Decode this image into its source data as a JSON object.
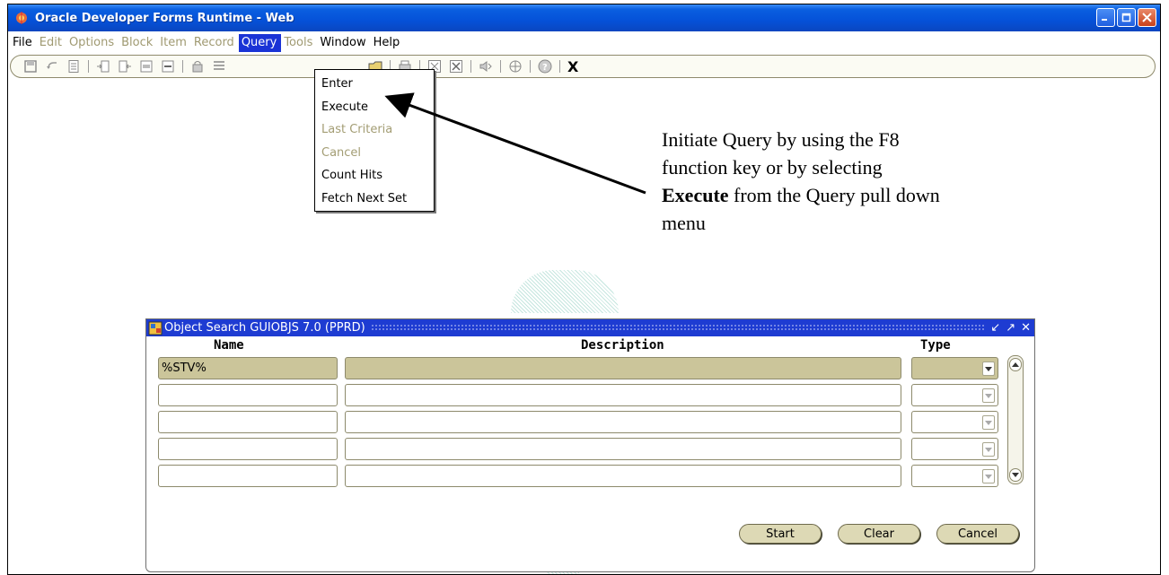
{
  "window": {
    "title": "Oracle Developer Forms Runtime - Web"
  },
  "menubar": {
    "items": [
      {
        "label": "File",
        "state": "enabled"
      },
      {
        "label": "Edit",
        "state": "disabled"
      },
      {
        "label": "Options",
        "state": "disabled"
      },
      {
        "label": "Block",
        "state": "disabled"
      },
      {
        "label": "Item",
        "state": "disabled"
      },
      {
        "label": "Record",
        "state": "disabled"
      },
      {
        "label": "Query",
        "state": "active"
      },
      {
        "label": "Tools",
        "state": "disabled"
      },
      {
        "label": "Window",
        "state": "enabled"
      },
      {
        "label": "Help",
        "state": "enabled"
      }
    ]
  },
  "toolbar": {
    "exit_label": "X"
  },
  "query_menu": {
    "items": [
      {
        "label": "Enter",
        "state": "enabled"
      },
      {
        "label": "Execute",
        "state": "enabled"
      },
      {
        "label": "Last Criteria",
        "state": "disabled"
      },
      {
        "label": "Cancel",
        "state": "disabled"
      },
      {
        "label": "Count Hits",
        "state": "enabled"
      },
      {
        "label": "Fetch Next Set",
        "state": "enabled"
      }
    ]
  },
  "annotation": {
    "line1": "Initiate Query by using the F8",
    "line2": "function key or by selecting",
    "bold": "Execute",
    "line3": " from the Query pull down",
    "line4": "menu"
  },
  "object_search": {
    "title": "Object Search  GUIOBJS  7.0  (PPRD)",
    "columns": {
      "name": "Name",
      "description": "Description",
      "type": "Type"
    },
    "rows": [
      {
        "name": "%STV%",
        "description": "",
        "type": ""
      },
      {
        "name": "",
        "description": "",
        "type": ""
      },
      {
        "name": "",
        "description": "",
        "type": ""
      },
      {
        "name": "",
        "description": "",
        "type": ""
      },
      {
        "name": "",
        "description": "",
        "type": ""
      }
    ],
    "buttons": {
      "start": "Start",
      "clear": "Clear",
      "cancel": "Cancel"
    }
  },
  "colors": {
    "titlebar": "#0551d8",
    "menu_active": "#1a33d6",
    "disabled_text": "#a09a72",
    "highlight_row": "#cbc59a",
    "button_face": "#ddd9b5"
  }
}
